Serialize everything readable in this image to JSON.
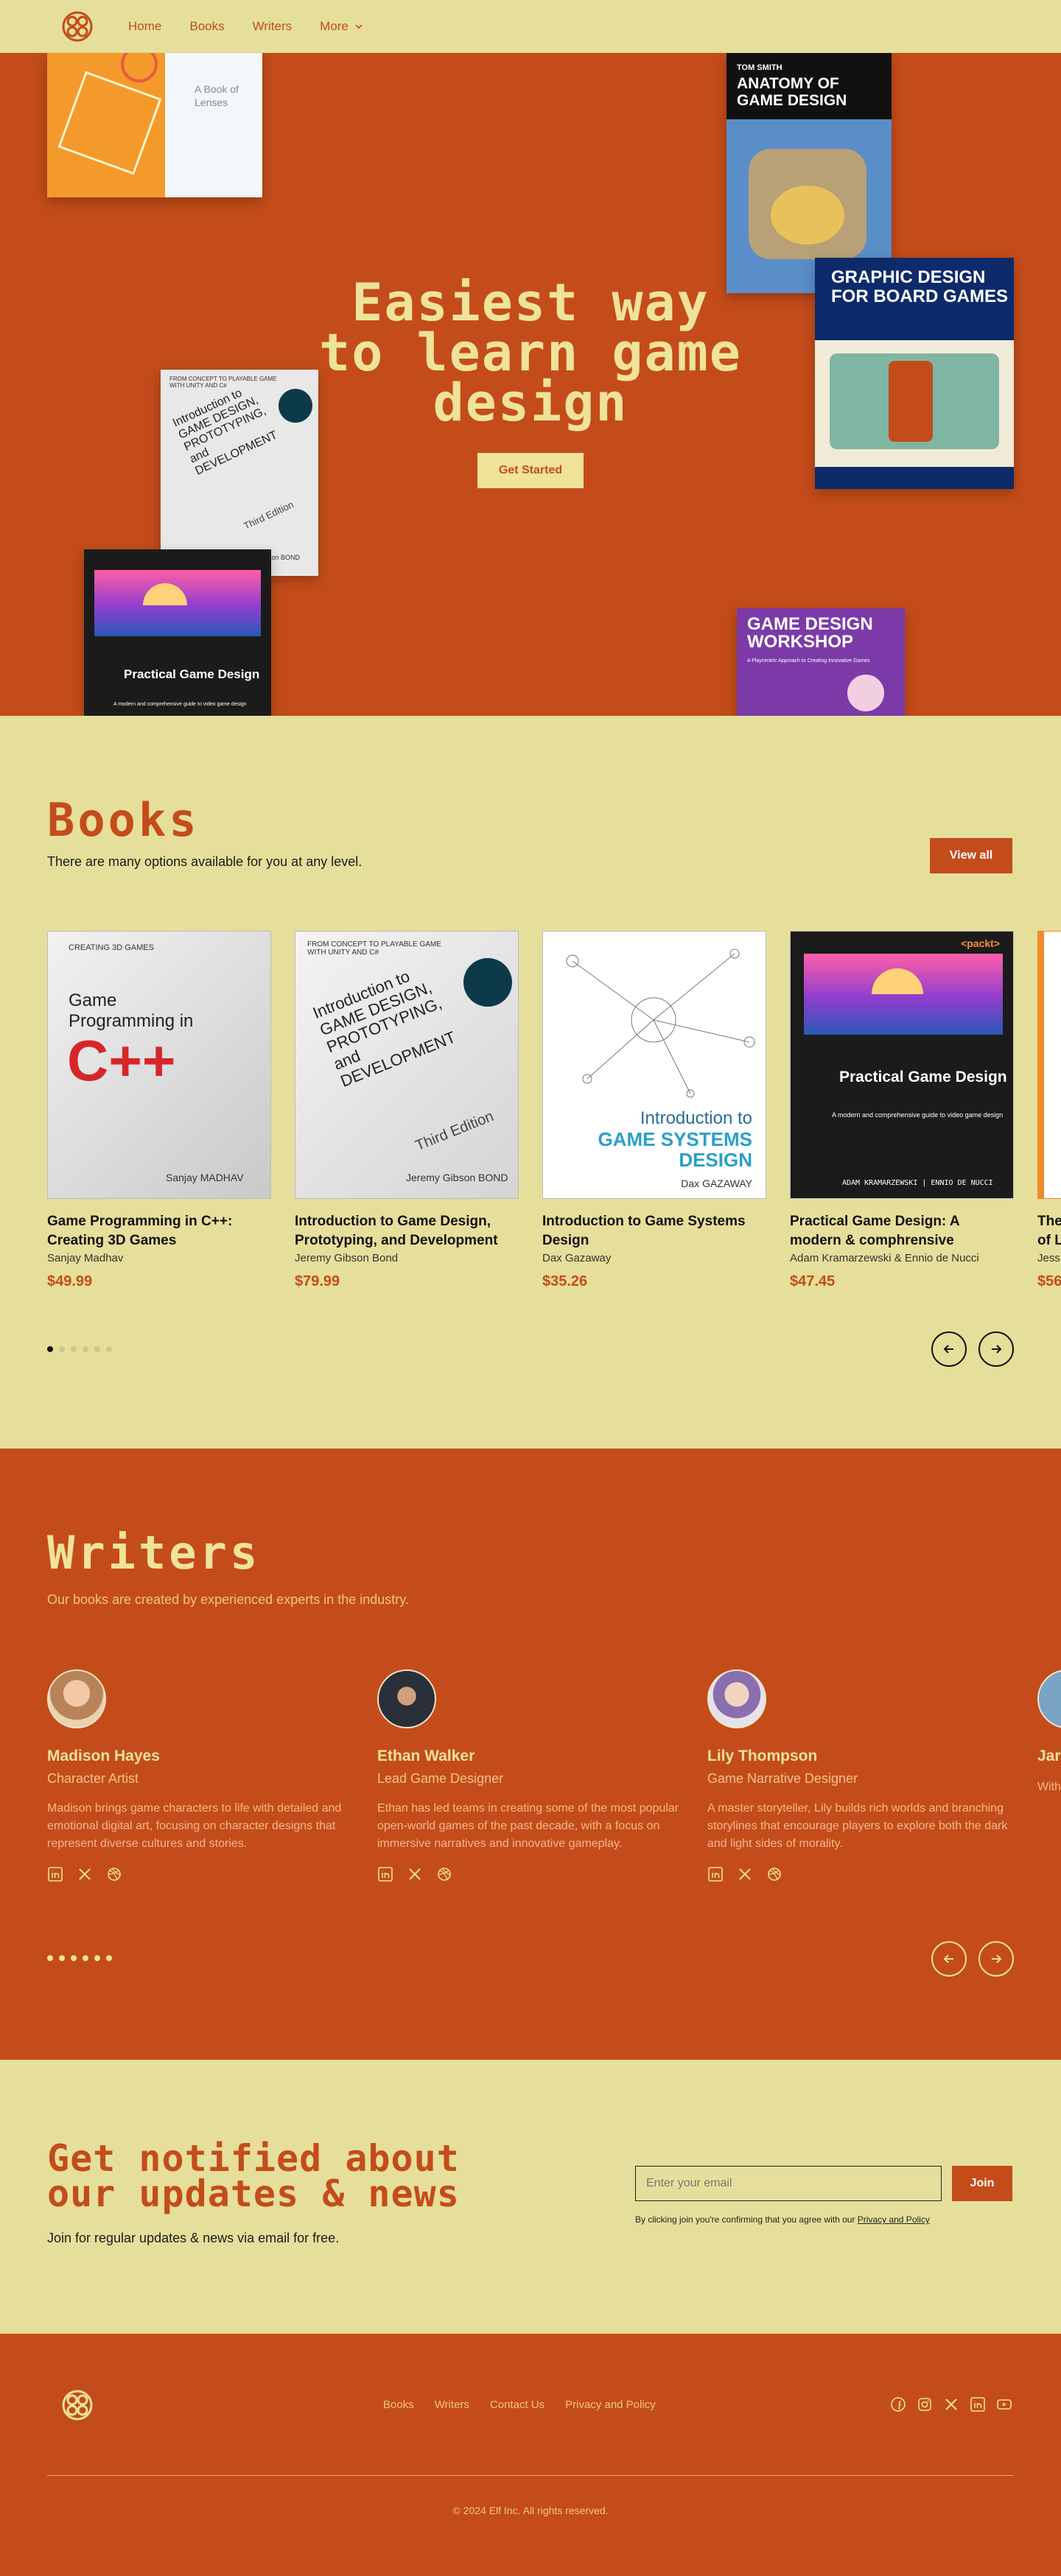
{
  "colors": {
    "accent": "#c44c1a",
    "cream": "#e6df9b",
    "pale": "#efe39a"
  },
  "nav": {
    "items": [
      {
        "label": "Home"
      },
      {
        "label": "Books"
      },
      {
        "label": "Writers"
      },
      {
        "label": "More"
      }
    ]
  },
  "hero": {
    "title_line1": "Easiest way",
    "title_line2": "to learn game",
    "title_line3": "design",
    "cta": "Get Started",
    "covers": {
      "lenses": {
        "title": "A Book of Lenses"
      },
      "anatomy": {
        "author": "TOM SMITH",
        "title": "ANATOMY OF GAME DESIGN"
      },
      "board": {
        "title": "GRAPHIC DESIGN FOR BOARD GAMES"
      },
      "intro": {
        "series": "FROM CONCEPT TO PLAYABLE GAME WITH UNITY AND C#",
        "title": "Introduction to GAME DESIGN, PROTOTYPING, and DEVELOPMENT",
        "edition": "Third Edition",
        "author": "Jeremy Gibson BOND"
      },
      "practical": {
        "title": "Practical Game Design",
        "tagline": "A modern and comprehensive guide to video game design"
      },
      "workshop": {
        "title": "GAME DESIGN WORKSHOP",
        "subtitle": "A Playcentric Approach to Creating Innovative Games"
      }
    }
  },
  "books": {
    "title": "Books",
    "subtitle": "There are many options available for you at any level.",
    "view_all": "View all",
    "items": [
      {
        "title": "Game Programming in C++: Creating 3D Games",
        "author": "Sanjay Madhav",
        "price": "$49.99",
        "cover_series": "CREATING 3D GAMES",
        "cover_title": "Game Programming in",
        "cover_big": "C++",
        "cover_author": "Sanjay MADHAV"
      },
      {
        "title": "Introduction to Game Design, Prototyping, and Development",
        "author": "Jeremy Gibson Bond",
        "price": "$79.99",
        "cover_series": "FROM CONCEPT TO PLAYABLE GAME WITH UNITY AND C#",
        "cover_title": "Introduction to GAME DESIGN, PROTOTYPING, and DEVELOPMENT",
        "cover_edition": "Third Edition",
        "cover_author": "Jeremy Gibson BOND"
      },
      {
        "title": "Introduction to Game Systems Design",
        "author": "Dax Gazaway",
        "price": "$35.26",
        "cover_title": "Introduction to",
        "cover_big": "GAME SYSTEMS DESIGN",
        "cover_author": "Dax GAZAWAY"
      },
      {
        "title": "Practical Game Design: A modern & comphrensive",
        "author": "Adam Kramarzewski  & Ennio de Nucci",
        "price": "$47.45",
        "cover_brand": "<packt>",
        "cover_title": "Practical Game Design",
        "cover_tagline": "A modern and comprehensive guide to video game design",
        "cover_authors": "ADAM KRAMARZEWSKI | ENNIO DE NUCCI"
      },
      {
        "title": "The",
        "title2": "of L",
        "author": "Jess",
        "price": "$56"
      }
    ]
  },
  "writers": {
    "title": "Writers",
    "subtitle": "Our books are created by experienced experts in the industry.",
    "items": [
      {
        "name": "Madison Hayes",
        "role": "Character Artist",
        "bio": "Madison brings game characters to life with detailed and emotional digital art, focusing on character designs that represent diverse cultures and stories."
      },
      {
        "name": "Ethan Walker",
        "role": " Lead Game Designer",
        "bio": "Ethan has led teams in creating some of the most popular open-world games of the past decade, with a focus on immersive narratives and innovative gameplay."
      },
      {
        "name": "Lily Thompson",
        "role": "Game Narrative Designer",
        "bio": "A master storyteller, Lily builds rich worlds and branching storylines that encourage players to explore both the dark and light sides of morality."
      },
      {
        "name": "Jar",
        "role": "",
        "bio": "With ... virtu..."
      }
    ]
  },
  "newsletter": {
    "title_line1": "Get notified about",
    "title_line2": "our updates & news",
    "subtitle": "Join for regular updates & news via email for free.",
    "placeholder": "Enter your email",
    "join": "Join",
    "legal_prefix": "By clicking join you're confirming that you agree with our ",
    "legal_link": "Privacy and Policy"
  },
  "footer": {
    "links": [
      {
        "label": "Books"
      },
      {
        "label": "Writers"
      },
      {
        "label": "Contact Us"
      },
      {
        "label": "Privacy and Policy"
      }
    ],
    "copyright": "© 2024 Elf Inc. All rights reserved."
  }
}
